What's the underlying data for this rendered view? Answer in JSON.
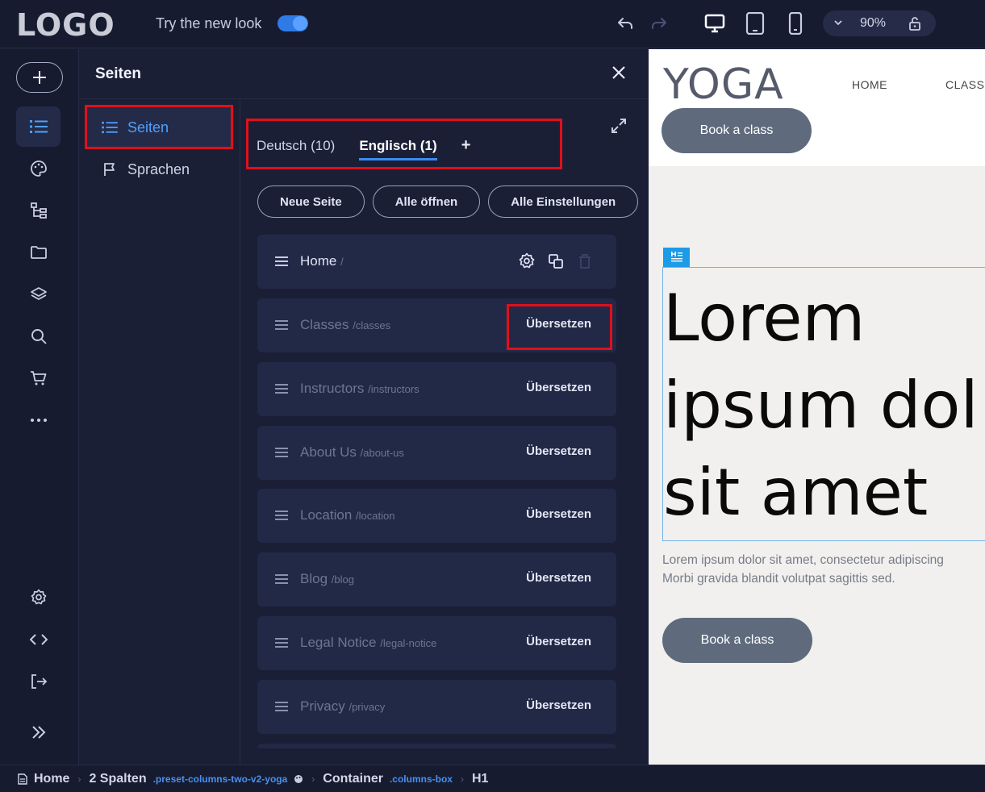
{
  "topbar": {
    "logo": "LOGO",
    "try_new_look": "Try the new look",
    "zoom": "90%"
  },
  "rail": {
    "items": [
      "list-icon",
      "palette-icon",
      "sitemap-icon",
      "folder-icon",
      "layers-icon",
      "search-icon",
      "cart-icon",
      "more-icon",
      "settings-icon",
      "code-icon",
      "logout-icon",
      "expand-icon"
    ]
  },
  "panel": {
    "title": "Seiten",
    "subnav": [
      "Seiten",
      "Sprachen"
    ],
    "tabs": [
      "Deutsch (10)",
      "Englisch (1)"
    ],
    "tab_add": "+",
    "buttons": [
      "Neue Seite",
      "Alle öffnen",
      "Alle Einstellungen"
    ],
    "pages": [
      {
        "name": "Home",
        "slug": "/"
      },
      {
        "name": "Classes",
        "slug": "/classes",
        "action": "Übersetzen"
      },
      {
        "name": "Instructors",
        "slug": "/instructors",
        "action": "Übersetzen"
      },
      {
        "name": "About Us",
        "slug": "/about-us",
        "action": "Übersetzen"
      },
      {
        "name": "Location",
        "slug": "/location",
        "action": "Übersetzen"
      },
      {
        "name": "Blog",
        "slug": "/blog",
        "action": "Übersetzen"
      },
      {
        "name": "Legal Notice",
        "slug": "/legal-notice",
        "action": "Übersetzen"
      },
      {
        "name": "Privacy",
        "slug": "/privacy",
        "action": "Übersetzen"
      }
    ]
  },
  "preview": {
    "logo": "YOGA",
    "nav": [
      "HOME",
      "CLASSE"
    ],
    "book_btn": "Book a class",
    "h1_lines": [
      "Lorem",
      "ipsum dol",
      "sit amet"
    ],
    "paragraph_lines": [
      "Lorem ipsum dolor sit amet, consectetur adipiscing",
      "Morbi gravida blandit volutpat sagittis sed."
    ],
    "book_btn_2": "Book a class"
  },
  "breadcrumb": {
    "home": "Home",
    "spalten": "2 Spalten",
    "spalten_class": ".preset-columns-two-v2-yoga",
    "container": "Container",
    "container_class": ".columns-box",
    "h1": "H1"
  },
  "colors": {
    "accent": "#3b8cf0",
    "highlight": "#e0101a",
    "panel_bg": "#1a1f36",
    "preview_button": "#5f6b7d"
  }
}
